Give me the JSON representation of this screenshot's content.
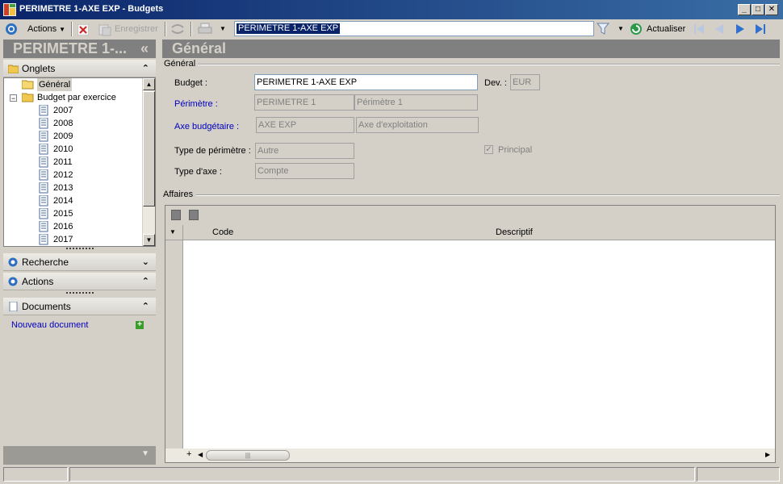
{
  "window": {
    "title": "PERIMETRE 1-AXE EXP  -  Budgets",
    "minimize": "_",
    "maximize": "□",
    "close": "✕"
  },
  "toolbar": {
    "actions_label": "Actions",
    "save_label": "Enregistrer",
    "search_value": "PERIMETRE 1-AXE EXP",
    "refresh_label": "Actualiser"
  },
  "left": {
    "header": "PERIMETRE 1-...",
    "collapse_glyph": "«",
    "tabs_section": "Onglets",
    "tree": {
      "general": "Général",
      "budget_folder": "Budget par exercice",
      "years": [
        "2007",
        "2008",
        "2009",
        "2010",
        "2011",
        "2012",
        "2013",
        "2014",
        "2015",
        "2016",
        "2017"
      ]
    },
    "search_section": "Recherche",
    "actions_section": "Actions",
    "documents_section": "Documents",
    "new_document": "Nouveau document"
  },
  "main": {
    "header": "Général",
    "group_general": "Général",
    "fields": {
      "budget_label": "Budget :",
      "budget_value": "PERIMETRE 1-AXE EXP",
      "currency_label": "Dev. :",
      "currency_value": "EUR",
      "perimeter_label": "Périmètre :",
      "perimeter_code": "PERIMETRE 1",
      "perimeter_desc": "Périmètre 1",
      "axis_label": "Axe budgétaire :",
      "axis_code": "AXE EXP",
      "axis_desc": "Axe d'exploitation",
      "perimeter_type_label": "Type de périmètre :",
      "perimeter_type_value": "Autre",
      "axis_type_label": "Type d'axe :",
      "axis_type_value": "Compte",
      "principal_label": "Principal",
      "principal_checked": true
    },
    "group_affaires": "Affaires",
    "grid": {
      "columns": [
        "Code",
        "Descriptif"
      ],
      "rows": []
    }
  }
}
